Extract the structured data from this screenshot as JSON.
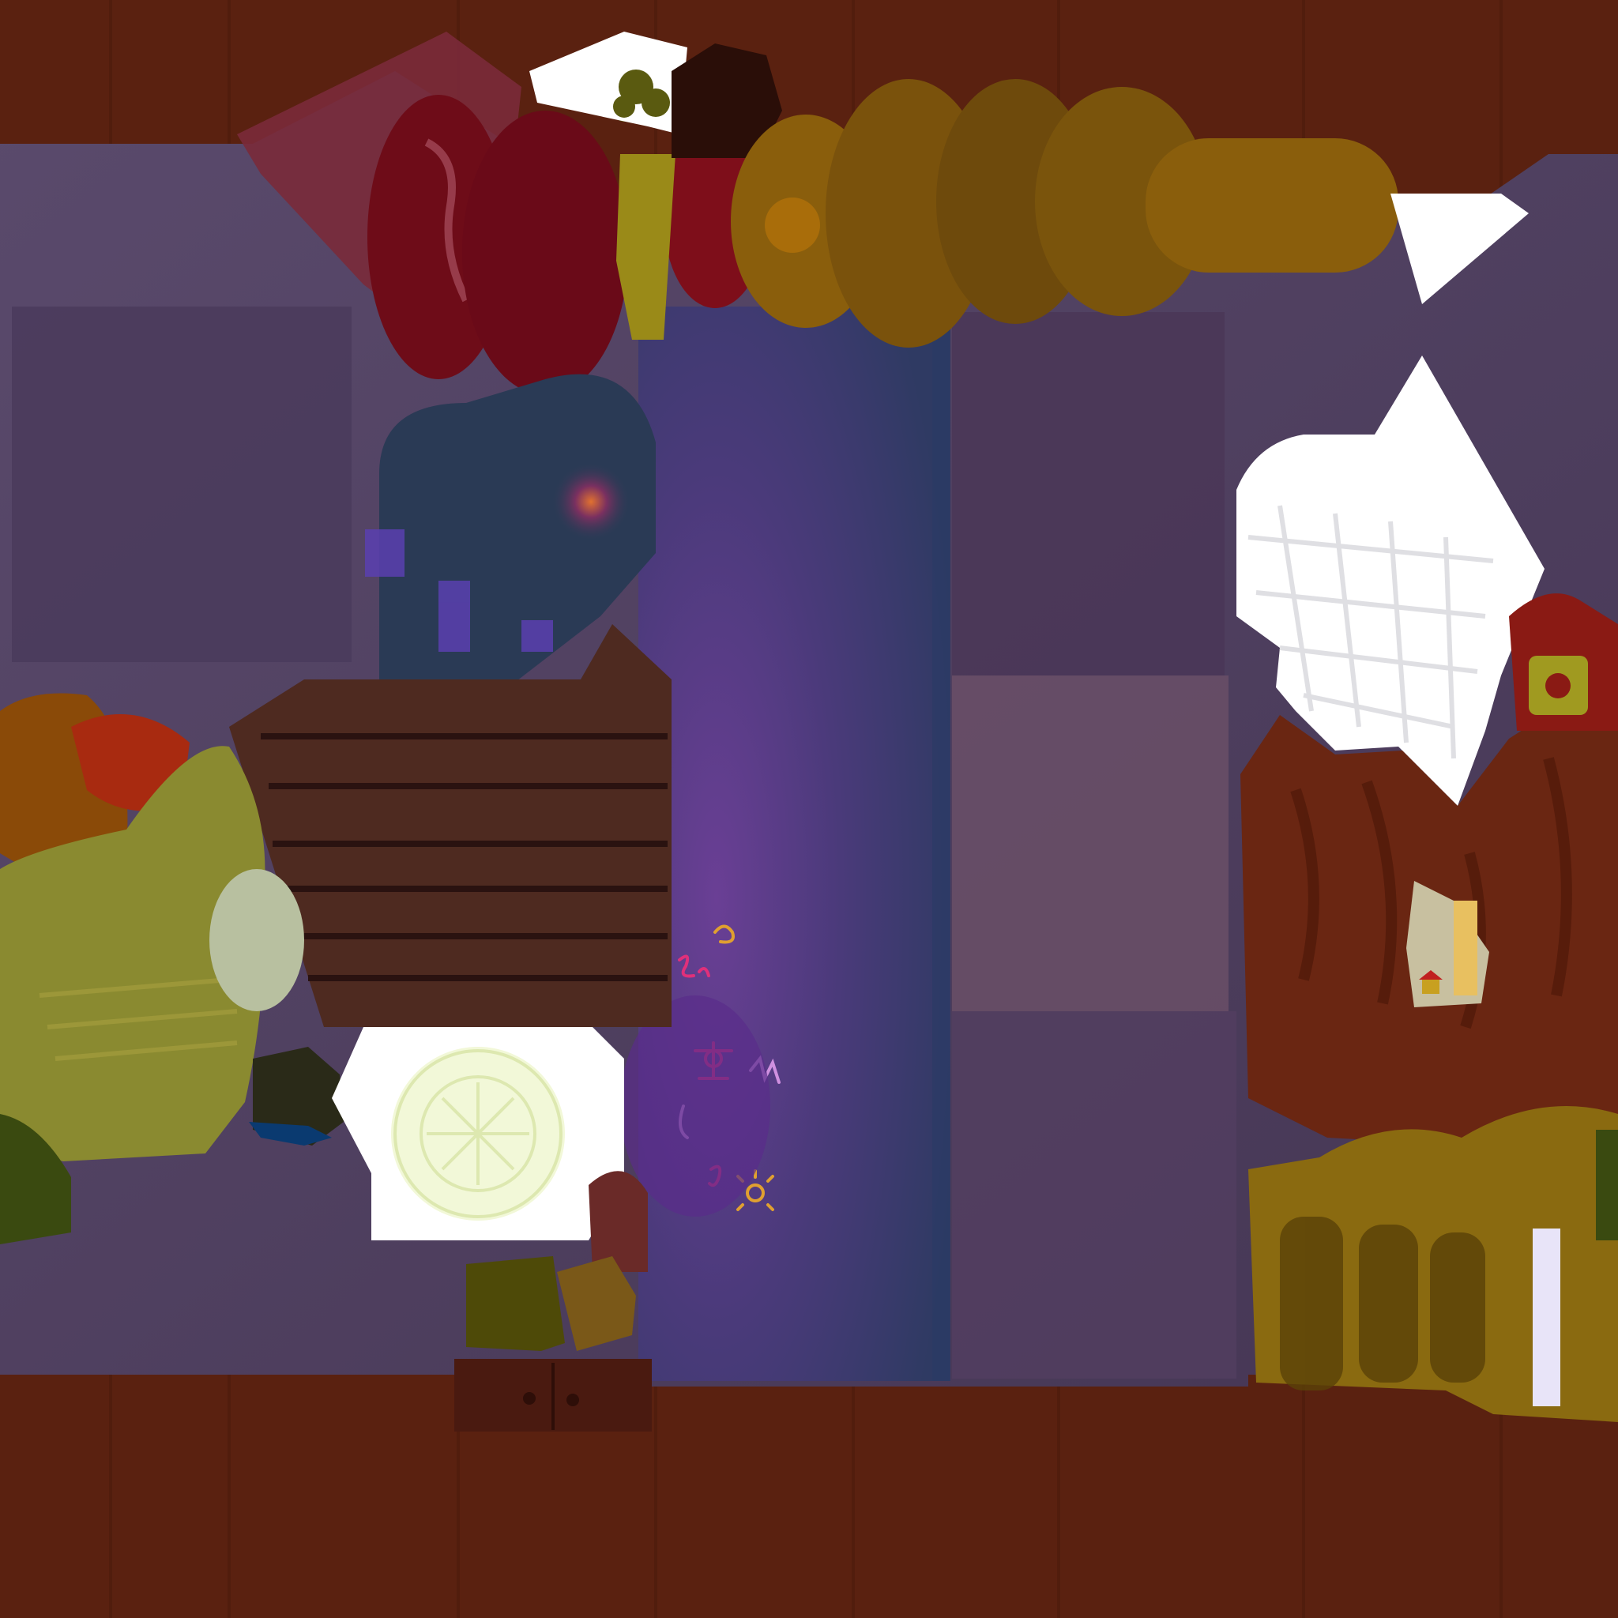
{
  "scene": {
    "type": "game-room-top-down",
    "palette": {
      "floor_wood": "#5a2110",
      "wall_purple": "#4e3a5c",
      "rug_purple": "#4a3a7a",
      "mustard": "#8a6a10",
      "crimson": "#6e0c18",
      "olive": "#8a8a30",
      "navy": "#2a3a55",
      "white_cutout": "#ffffff"
    },
    "objects": [
      {
        "id": "crimson-cushions",
        "color": "#6e0c18"
      },
      {
        "id": "mustard-cushion-row",
        "color": "#8a5e0c"
      },
      {
        "id": "navy-pillow-stack",
        "color": "#2a3a55"
      },
      {
        "id": "wooden-crate",
        "color": "#4e2a20"
      },
      {
        "id": "chalk-rug",
        "color": "#4a3a7a"
      },
      {
        "id": "lace-pillow",
        "color": "#ffffff"
      },
      {
        "id": "olive-armchair",
        "color": "#8a8a30"
      },
      {
        "id": "emblem-plate",
        "color": "#f2f8d8"
      },
      {
        "id": "brown-sofa",
        "color": "#6a2612"
      },
      {
        "id": "mustard-sofa-base",
        "color": "#8a6a10"
      },
      {
        "id": "small-drawer",
        "color": "#4a1a10"
      },
      {
        "id": "window-picture",
        "color": "#e8c060"
      }
    ]
  }
}
